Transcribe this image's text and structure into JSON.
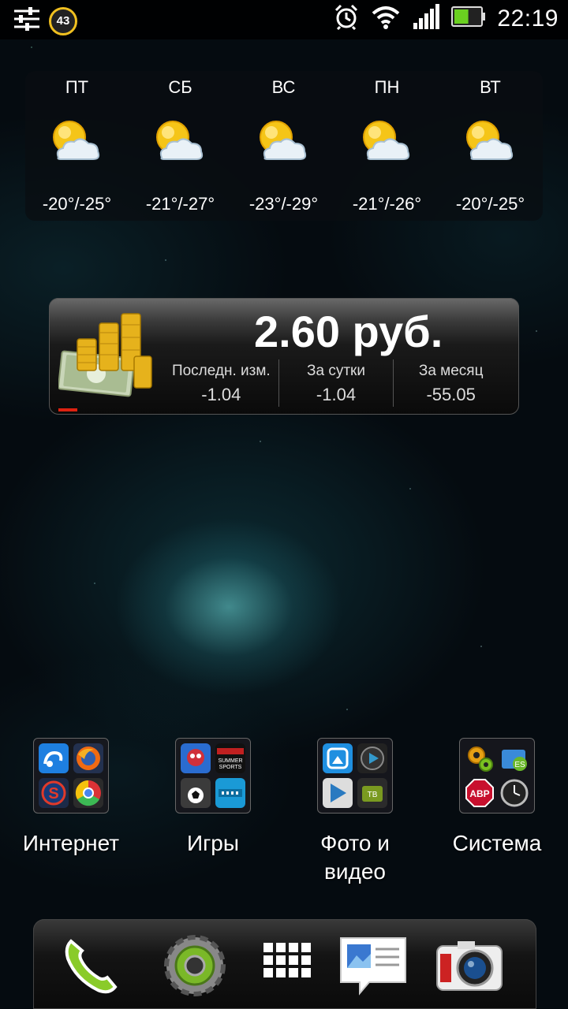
{
  "status_bar": {
    "notification_count": "43",
    "time": "22:19",
    "battery_level": 0.55
  },
  "weather": {
    "days": [
      {
        "day": "ПТ",
        "temp": "-20°/-25°",
        "icon": "partly-cloudy-icon"
      },
      {
        "day": "СБ",
        "temp": "-21°/-27°",
        "icon": "partly-cloudy-icon"
      },
      {
        "day": "ВС",
        "temp": "-23°/-29°",
        "icon": "partly-cloudy-icon"
      },
      {
        "day": "ПН",
        "temp": "-21°/-26°",
        "icon": "partly-cloudy-icon"
      },
      {
        "day": "ВТ",
        "temp": "-20°/-25°",
        "icon": "partly-cloudy-icon"
      }
    ]
  },
  "currency": {
    "price": "2.60 руб.",
    "last_change_label": "Последн. изм.",
    "last_change_value": "-1.04",
    "day_label": "За сутки",
    "day_value": "-1.04",
    "month_label": "За месяц",
    "month_value": "-55.05"
  },
  "folders": [
    {
      "label": "Интернет",
      "apps": [
        "uc-browser-icon",
        "firefox-icon",
        "skyfire-icon",
        "chrome-icon"
      ]
    },
    {
      "label": "Игры",
      "apps": [
        "game-icon",
        "summer-sports-icon",
        "soccer-icon",
        "game-100-icon"
      ]
    },
    {
      "label": "Фото и видео",
      "apps": [
        "quickpic-icon",
        "video-player-icon",
        "play-movies-icon",
        "tv-icon"
      ]
    },
    {
      "label": "Система",
      "apps": [
        "settings-gears-icon",
        "es-file-explorer-icon",
        "adblock-plus-icon",
        "clock-icon"
      ]
    }
  ],
  "folder_labels": {
    "internet": "Интернет",
    "games": "Игры",
    "photo_line1": "Фото и",
    "photo_line2": "видео",
    "system": "Система"
  },
  "dock": [
    "phone-icon",
    "settings-icon",
    "app-drawer-icon",
    "messages-icon",
    "camera-icon"
  ],
  "colors": {
    "accent_yellow": "#f0c020",
    "status_red": "#dd2211"
  }
}
